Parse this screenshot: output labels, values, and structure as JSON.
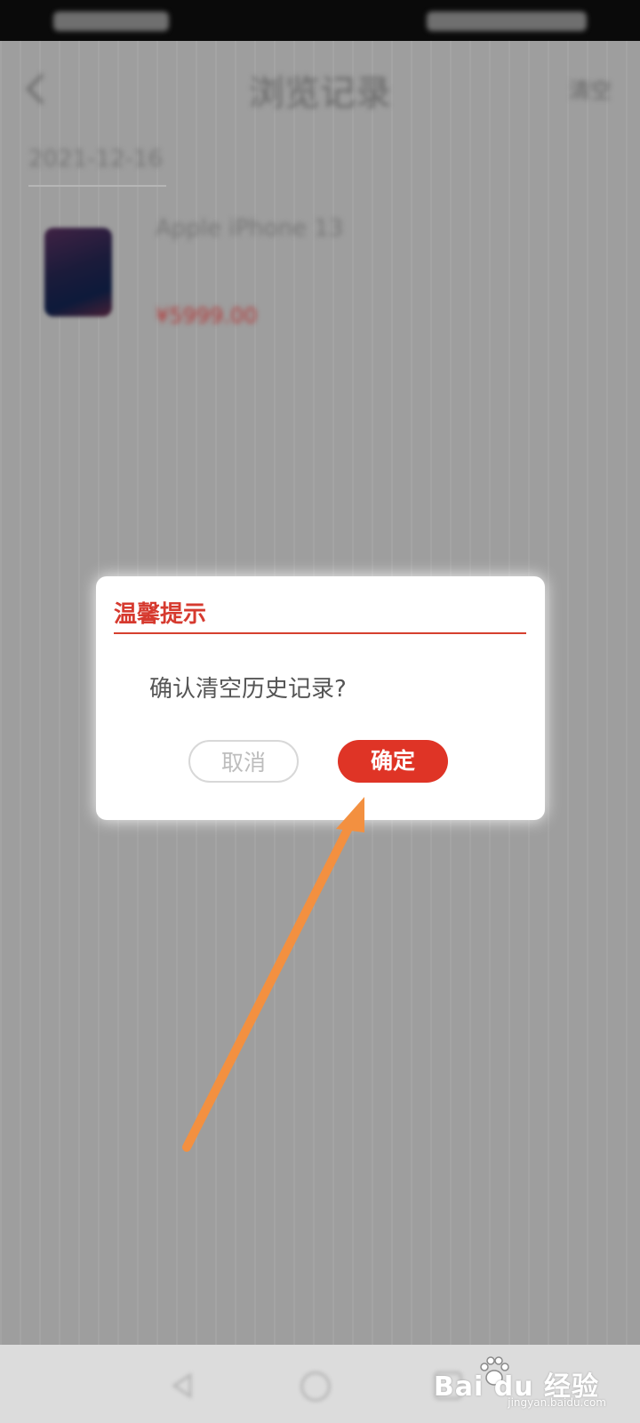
{
  "background": {
    "page_title": "浏览记录",
    "clear_label": "清空",
    "date": "2021-12-16",
    "product_name": "Apple iPhone 13",
    "product_price": "¥5999.00"
  },
  "dialog": {
    "title": "温馨提示",
    "message": "确认清空历史记录?",
    "cancel_label": "取消",
    "confirm_label": "确定"
  },
  "watermark": {
    "brand": "Bai du 经验",
    "url": "jingyan.baidu.com"
  },
  "colors": {
    "accent": "#df3426",
    "overlay": "#9e9e9e",
    "annotation_arrow": "#f39040"
  },
  "icons": [
    "back-icon",
    "nav-back-icon",
    "nav-home-icon",
    "nav-recent-icon",
    "paw-icon"
  ]
}
